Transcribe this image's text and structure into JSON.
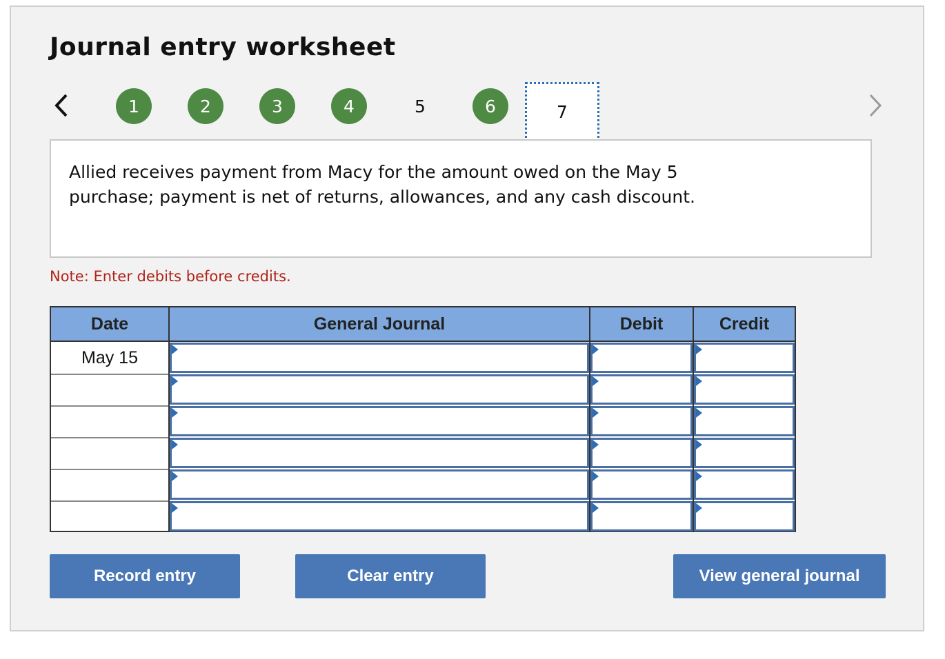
{
  "page": {
    "title": "Journal entry worksheet",
    "description": "Allied receives payment from Macy for the amount owed on the May 5 purchase; payment is net of returns, allowances, and any cash discount.",
    "note": "Note: Enter debits before credits."
  },
  "stepper": {
    "prev_icon": "chevron-left-icon",
    "next_icon": "chevron-right-icon",
    "steps": [
      {
        "label": "1",
        "state": "completed"
      },
      {
        "label": "2",
        "state": "completed"
      },
      {
        "label": "3",
        "state": "completed"
      },
      {
        "label": "4",
        "state": "completed"
      },
      {
        "label": "5",
        "state": "incomplete"
      },
      {
        "label": "6",
        "state": "completed"
      },
      {
        "label": "7",
        "state": "current"
      }
    ]
  },
  "journal": {
    "headers": {
      "date": "Date",
      "general_journal": "General Journal",
      "debit": "Debit",
      "credit": "Credit"
    },
    "rows": [
      {
        "date": "May 15",
        "account": "",
        "debit": "",
        "credit": ""
      },
      {
        "date": "",
        "account": "",
        "debit": "",
        "credit": ""
      },
      {
        "date": "",
        "account": "",
        "debit": "",
        "credit": ""
      },
      {
        "date": "",
        "account": "",
        "debit": "",
        "credit": ""
      },
      {
        "date": "",
        "account": "",
        "debit": "",
        "credit": ""
      },
      {
        "date": "",
        "account": "",
        "debit": "",
        "credit": ""
      }
    ]
  },
  "buttons": {
    "record": "Record entry",
    "clear": "Clear entry",
    "view": "View general journal"
  },
  "colors": {
    "step_completed": "#4e8a43",
    "header_bg": "#7ea8de",
    "button_bg": "#4a78b6",
    "note_text": "#b02418",
    "active_step_border": "#2e6db4"
  }
}
